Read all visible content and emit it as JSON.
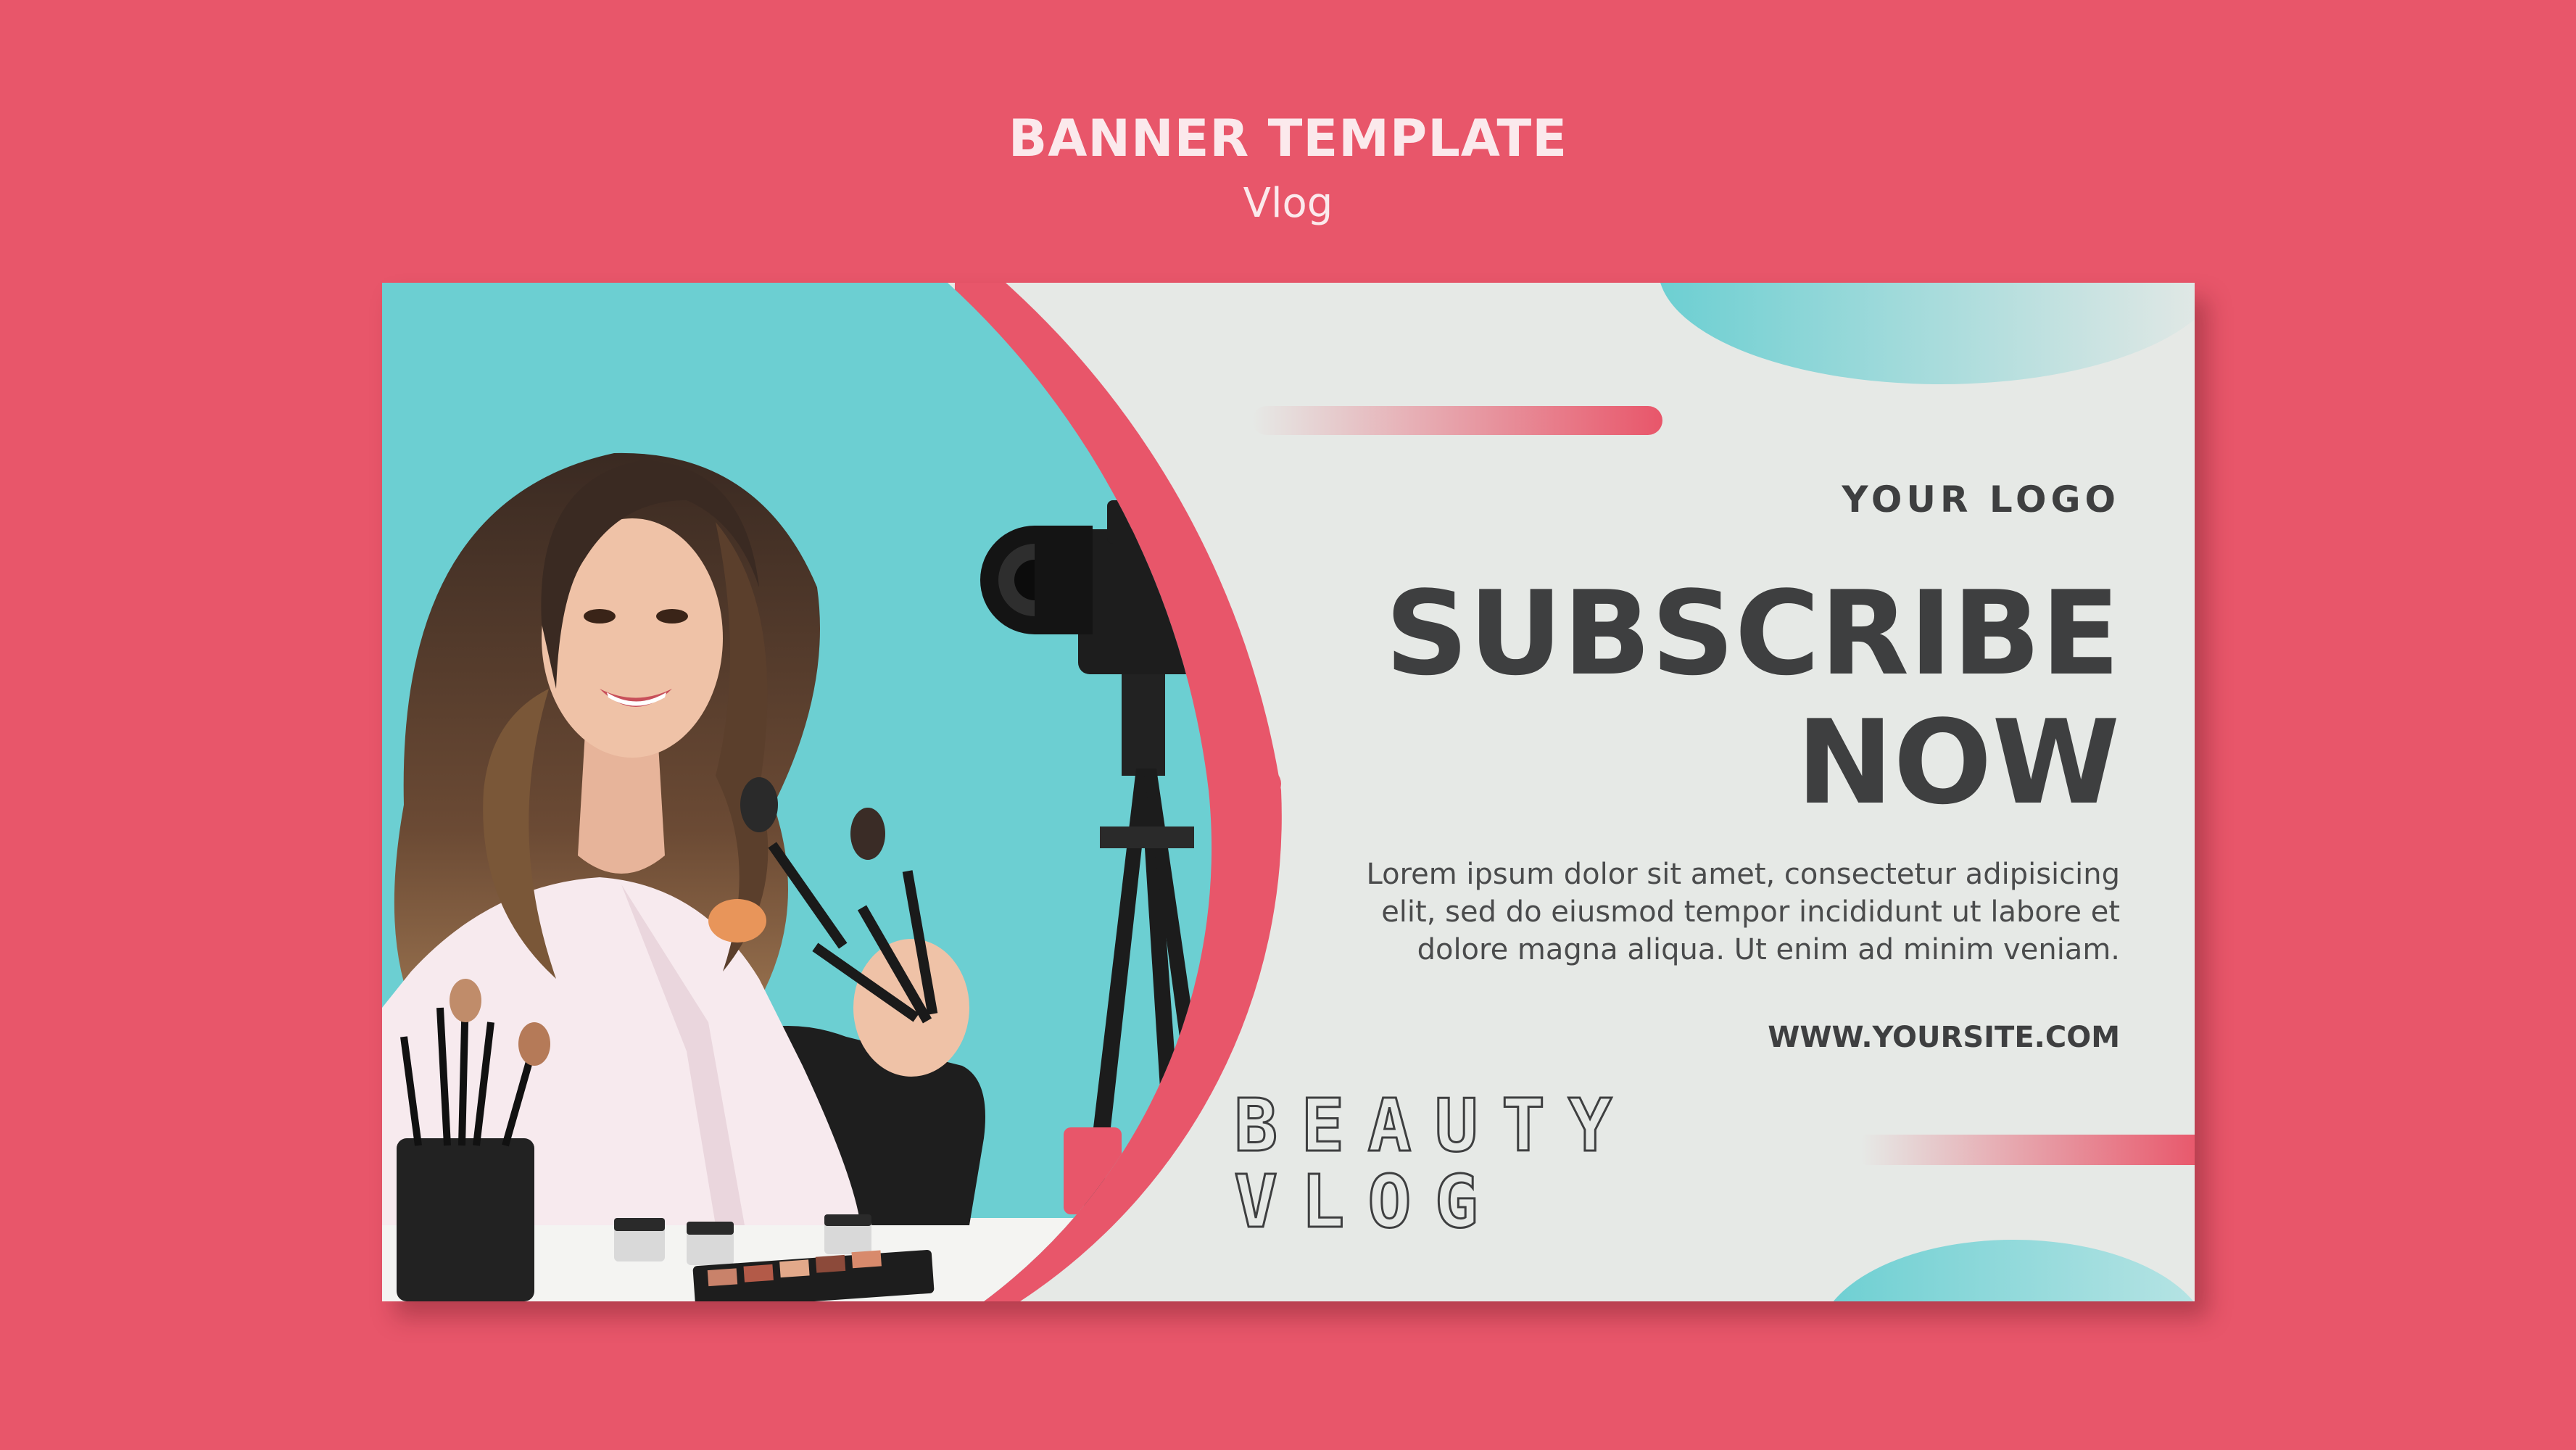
{
  "header": {
    "title": "BANNER TEMPLATE",
    "subtitle": "Vlog"
  },
  "banner": {
    "logo": "YOUR LOGO",
    "headline_line1": "SUBSCRIBE",
    "headline_line2": "NOW",
    "body_line1": "Lorem ipsum dolor sit amet, consectetur adipisicing",
    "body_line2": "elit, sed do eiusmod tempor incididunt ut labore et",
    "body_line3": "dolore magna aliqua. Ut enim ad minim veniam.",
    "website": "WWW.YOURSITE.COM",
    "beauty_line1": "BEAUTY",
    "beauty_line2": "VLOG"
  },
  "photo": {
    "subject": "woman-holding-makeup-brushes",
    "props": [
      "camera-on-tripod",
      "brush-holder",
      "cosmetic-jars",
      "eyeshadow-palette"
    ]
  },
  "colors": {
    "page_background": "#e8566a",
    "banner_background": "#e6e9e6",
    "accent_pink": "#e8566a",
    "accent_teal": "#6ccfd2",
    "text_dark": "#3e3f40",
    "header_text": "#fbe9ec"
  }
}
